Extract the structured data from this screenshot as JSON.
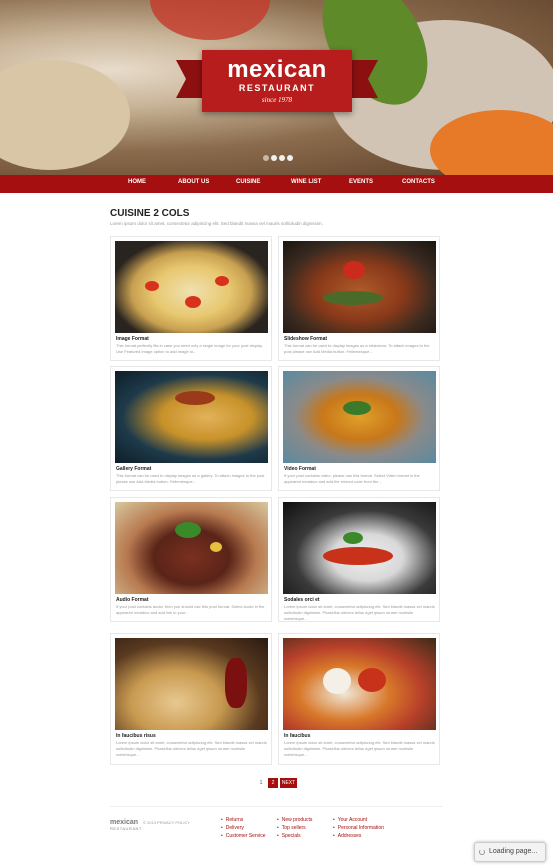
{
  "brand": {
    "name": "mexican",
    "subtitle": "RESTAURANT",
    "since": "since 1978"
  },
  "nav": [
    {
      "label": "HOME"
    },
    {
      "label": "ABOUT US"
    },
    {
      "label": "CUISINE"
    },
    {
      "label": "WINE LIST"
    },
    {
      "label": "EVENTS"
    },
    {
      "label": "CONTACTS"
    }
  ],
  "section": {
    "title": "CUISINE 2 COLS",
    "description": "Lorem ipsum dolor sit amet, consectetur adipiscing elit. Sed blandit massa vel mauris sollicitudin dignissim."
  },
  "cards": [
    {
      "title": "Image Format",
      "desc": "This format perfectly fits in case you need only a single image for your post display. Use Featured Image option to add image to..."
    },
    {
      "title": "Slideshow Format",
      "desc": "This format can be used to display images as a slideshow. To attach images to the post please use Add Media button. Fellentesque..."
    },
    {
      "title": "Gallery Format",
      "desc": "This format can be used to display images as a gallery. To attach images to the post please use Add Media button. Fellentesque..."
    },
    {
      "title": "Video Format",
      "desc": "If your post contains video, please use this format. Select Video format in the appeared metabox and add the embed code from the..."
    },
    {
      "title": "Audio Format",
      "desc": "If your post contains audio, then you should use this post format. Select Audio in the appeared metabox and add link to your..."
    },
    {
      "title": "Sodales orci et",
      "desc": "Lorem ipsum dolor sit amet, consectetur adipiscing elit. Sed blandit massa vel mauris sollicitudin dignissim. Phasellus ultrices tellus eget ipsum ornare molestie scelerisque..."
    },
    {
      "title": "In faucibus risus",
      "desc": "Lorem ipsum dolor sit amet, consectetur adipiscing elit. Sed blandit massa vel mauris sollicitudin dignissim. Phasellus ultrices tellus eget ipsum ornare molestie scelerisque..."
    },
    {
      "title": "In faucibus",
      "desc": "Lorem ipsum dolor sit amet, consectetur adipiscing elit. Sed blandit massa vel mauris sollicitudin dignissim. Phasellus ultrices tellus eget ipsum ornare molestie scelerisque..."
    }
  ],
  "pagination": {
    "pages": [
      "1",
      "2"
    ],
    "current": "2",
    "next": "NEXT"
  },
  "footer": {
    "logo": "mexican",
    "logo_sub": "RESTAURANT",
    "copyright": "© 2013 PRIVACY POLICY",
    "col1": [
      "Returns",
      "Delivery",
      "Customer Service"
    ],
    "col2": [
      "New products",
      "Top sellers",
      "Specials"
    ],
    "col3": [
      "Your Account",
      "Personal Information",
      "Addresses"
    ]
  },
  "loading": "Loading page...",
  "colors": {
    "accent": "#a50f0f",
    "ribbon": "#b81d1d"
  }
}
